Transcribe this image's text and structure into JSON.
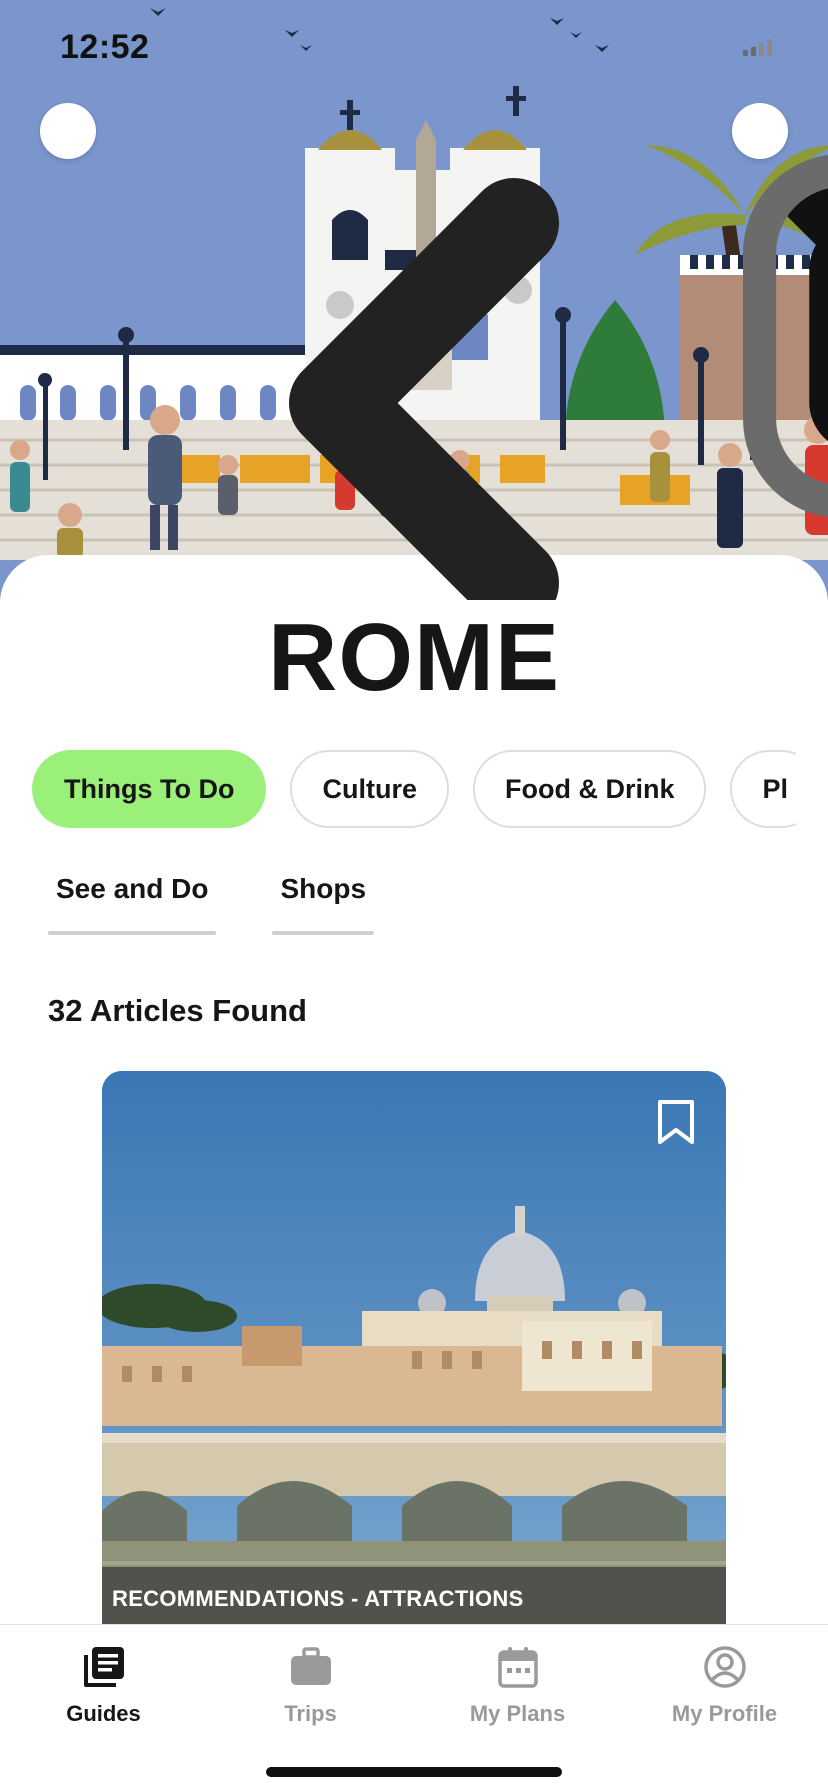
{
  "status_bar": {
    "time": "12:52"
  },
  "header": {
    "back_icon": "chevron-left-icon",
    "search_icon": "search-icon"
  },
  "city": {
    "title": "ROME"
  },
  "categories": [
    {
      "label": "Things To Do",
      "active": true
    },
    {
      "label": "Culture",
      "active": false
    },
    {
      "label": "Food & Drink",
      "active": false
    },
    {
      "label": "Pl",
      "active": false
    }
  ],
  "subtabs": [
    {
      "label": "See and Do"
    },
    {
      "label": "Shops"
    }
  ],
  "results": {
    "count_text": "32 Articles Found"
  },
  "article": {
    "category_label": "RECOMMENDATIONS - ATTRACTIONS",
    "bookmark_icon": "bookmark-icon"
  },
  "tabbar": {
    "items": [
      {
        "label": "Guides",
        "icon": "guides-icon",
        "active": true
      },
      {
        "label": "Trips",
        "icon": "briefcase-icon",
        "active": false
      },
      {
        "label": "My Plans",
        "icon": "calendar-icon",
        "active": false
      },
      {
        "label": "My Profile",
        "icon": "profile-icon",
        "active": false
      }
    ]
  },
  "colors": {
    "accent_chip": "#9bf07a",
    "hero_sky": "#7a96cd",
    "text_primary": "#161616",
    "tab_inactive": "#9a9a9a"
  }
}
